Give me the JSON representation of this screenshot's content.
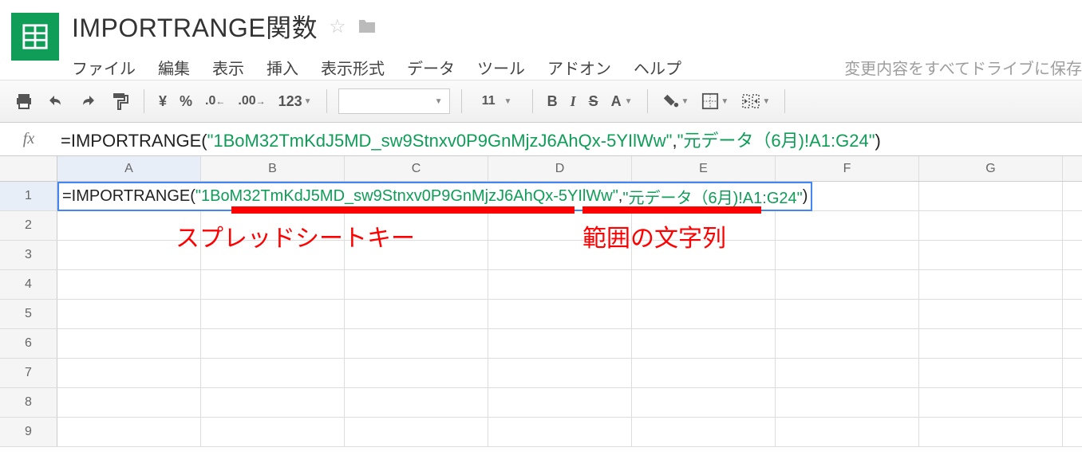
{
  "header": {
    "title": "IMPORTRANGE関数",
    "menu": [
      "ファイル",
      "編集",
      "表示",
      "挿入",
      "表示形式",
      "データ",
      "ツール",
      "アドオン",
      "ヘルプ"
    ],
    "save_status": "変更内容をすべてドライブに保存"
  },
  "toolbar": {
    "currency": "¥",
    "percent": "%",
    "dec_dec": ".0",
    "dec_inc": ".00",
    "num_fmt": "123",
    "font_size": "11"
  },
  "formula": {
    "prefix": "=IMPORTRANGE(",
    "arg1": "\"1BoM32TmKdJ5MD_sw9Stnxv0P9GnMjzJ6AhQx-5YIlWw\"",
    "comma": ",",
    "arg2": "\"元データ（6月)!A1:G24\"",
    "suffix": ")"
  },
  "columns": [
    "A",
    "B",
    "C",
    "D",
    "E",
    "F",
    "G"
  ],
  "rows": [
    "1",
    "2",
    "3",
    "4",
    "5",
    "6",
    "7",
    "8",
    "9"
  ],
  "annotations": {
    "label1": "スプレッドシートキー",
    "label2": "範囲の文字列"
  }
}
